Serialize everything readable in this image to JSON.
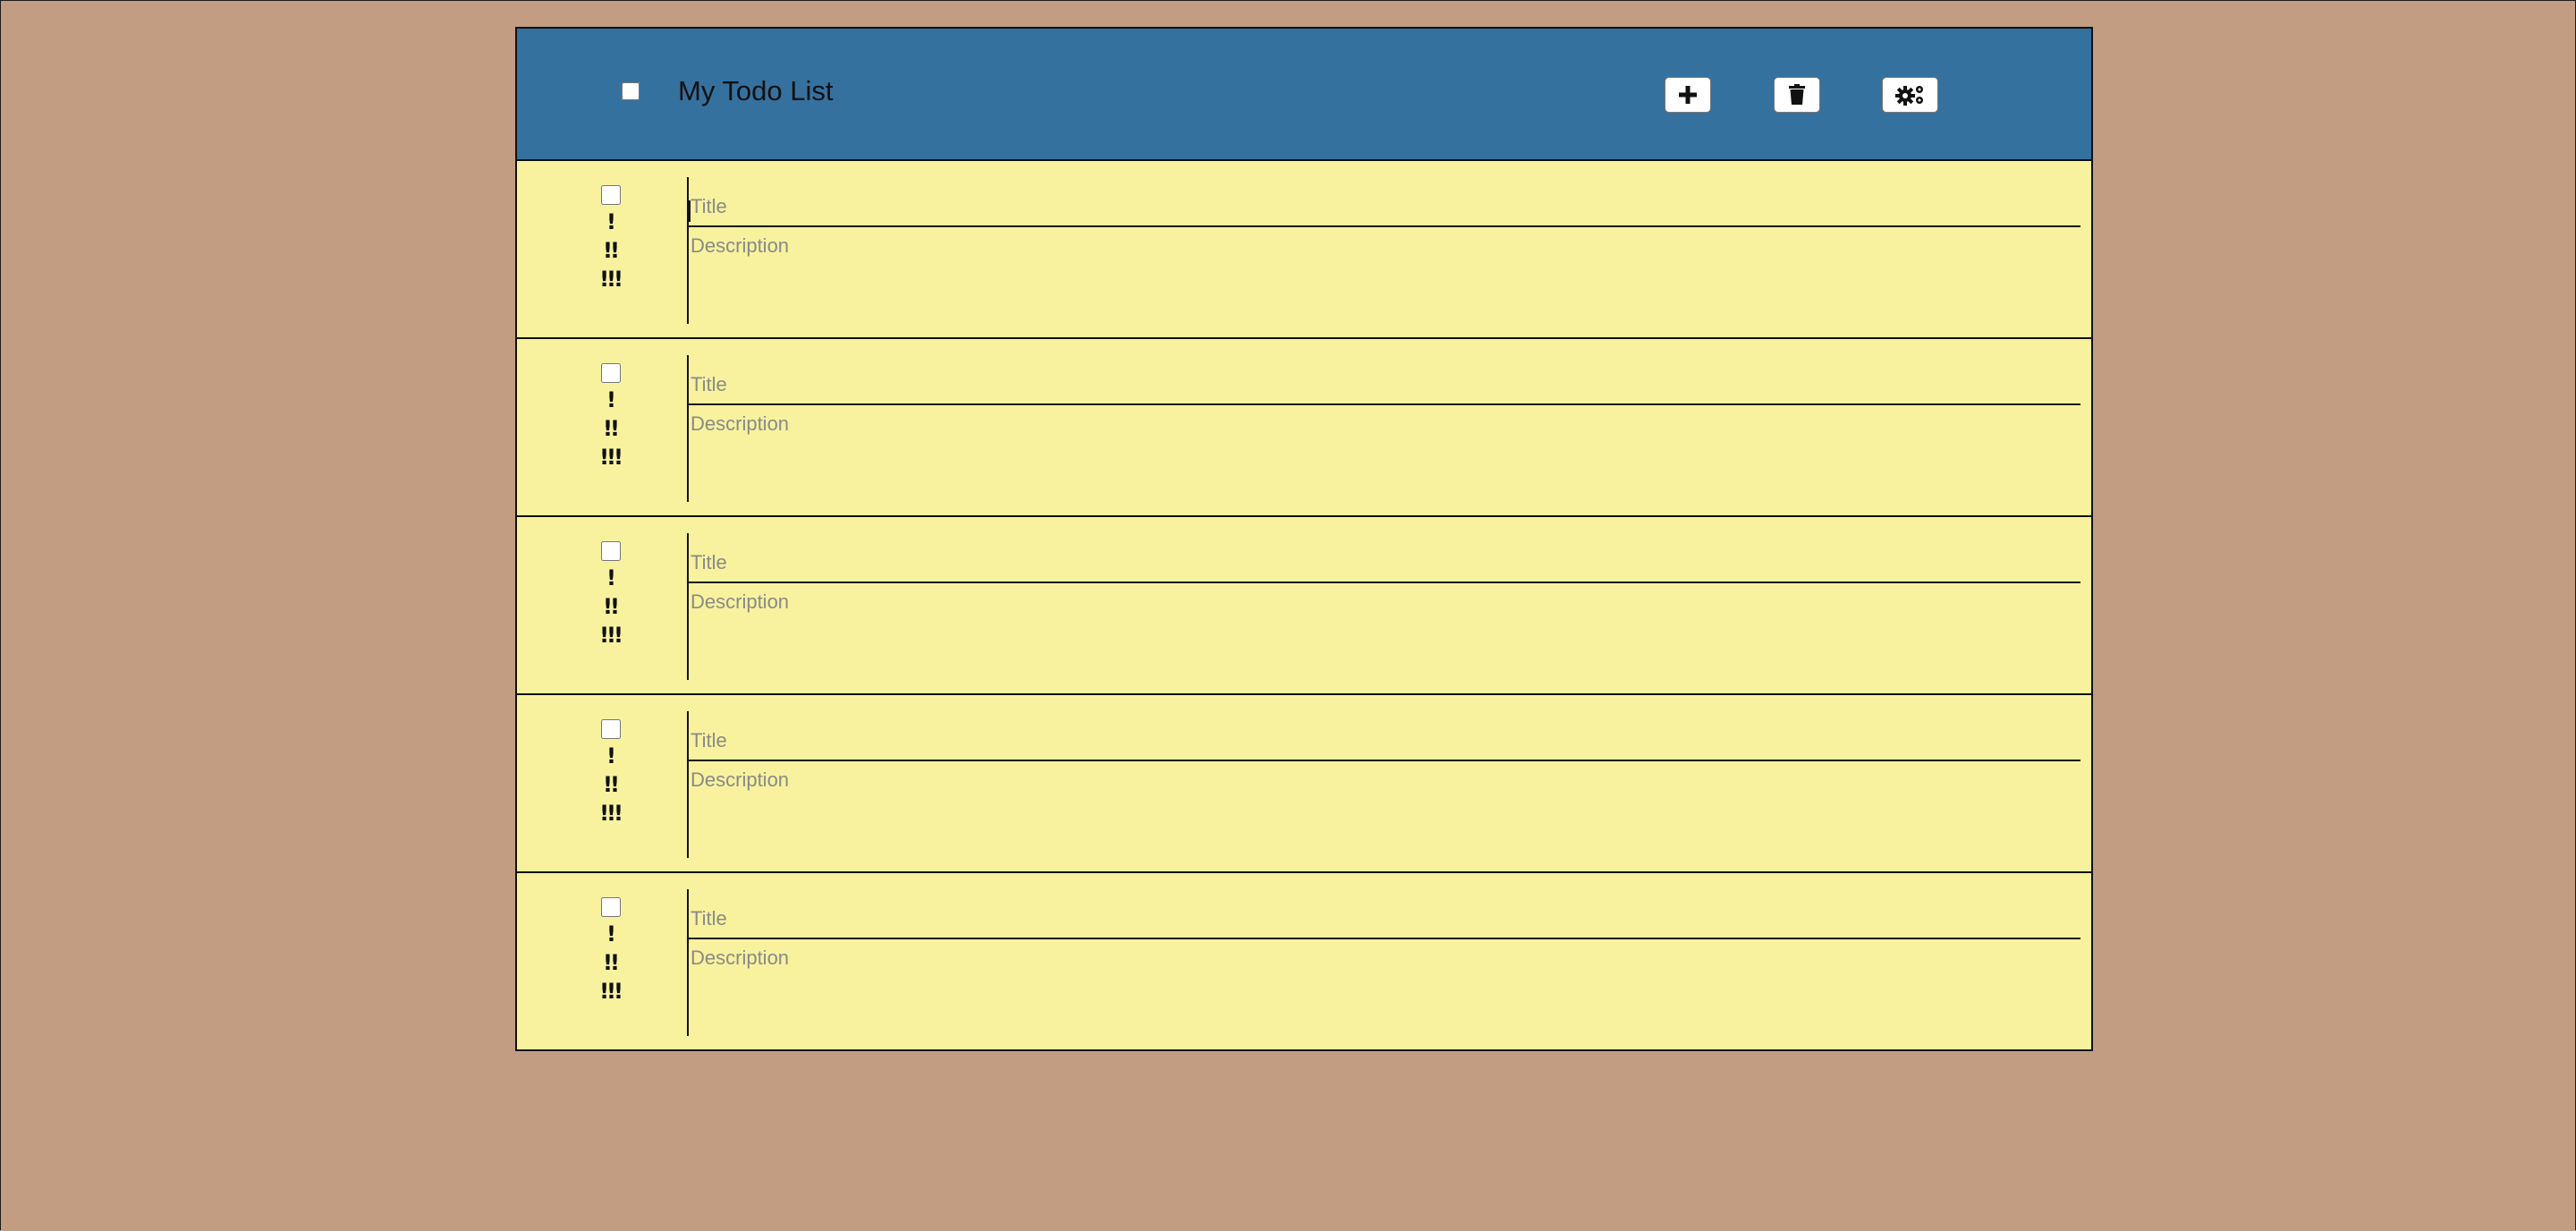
{
  "header": {
    "title": "My Todo List",
    "add_icon": "plus-icon",
    "delete_icon": "trash-icon",
    "settings_icon": "gears-icon"
  },
  "todos": [
    {
      "title": "",
      "title_placeholder": "Title",
      "description": "",
      "description_placeholder": "Description",
      "done": false,
      "focused": true
    },
    {
      "title": "",
      "title_placeholder": "Title",
      "description": "",
      "description_placeholder": "Description",
      "done": false
    },
    {
      "title": "",
      "title_placeholder": "Title",
      "description": "",
      "description_placeholder": "Description",
      "done": false
    },
    {
      "title": "",
      "title_placeholder": "Title",
      "description": "",
      "description_placeholder": "Description",
      "done": false
    },
    {
      "title": "",
      "title_placeholder": "Title",
      "description": "",
      "description_placeholder": "Description",
      "done": false
    }
  ],
  "priority_labels": [
    "!",
    "!!",
    "!!!"
  ],
  "colors": {
    "page_background": "#c39d82",
    "header_background": "#35719f",
    "item_background": "#f8f29f",
    "border": "#111111",
    "placeholder": "#8a8a86"
  }
}
